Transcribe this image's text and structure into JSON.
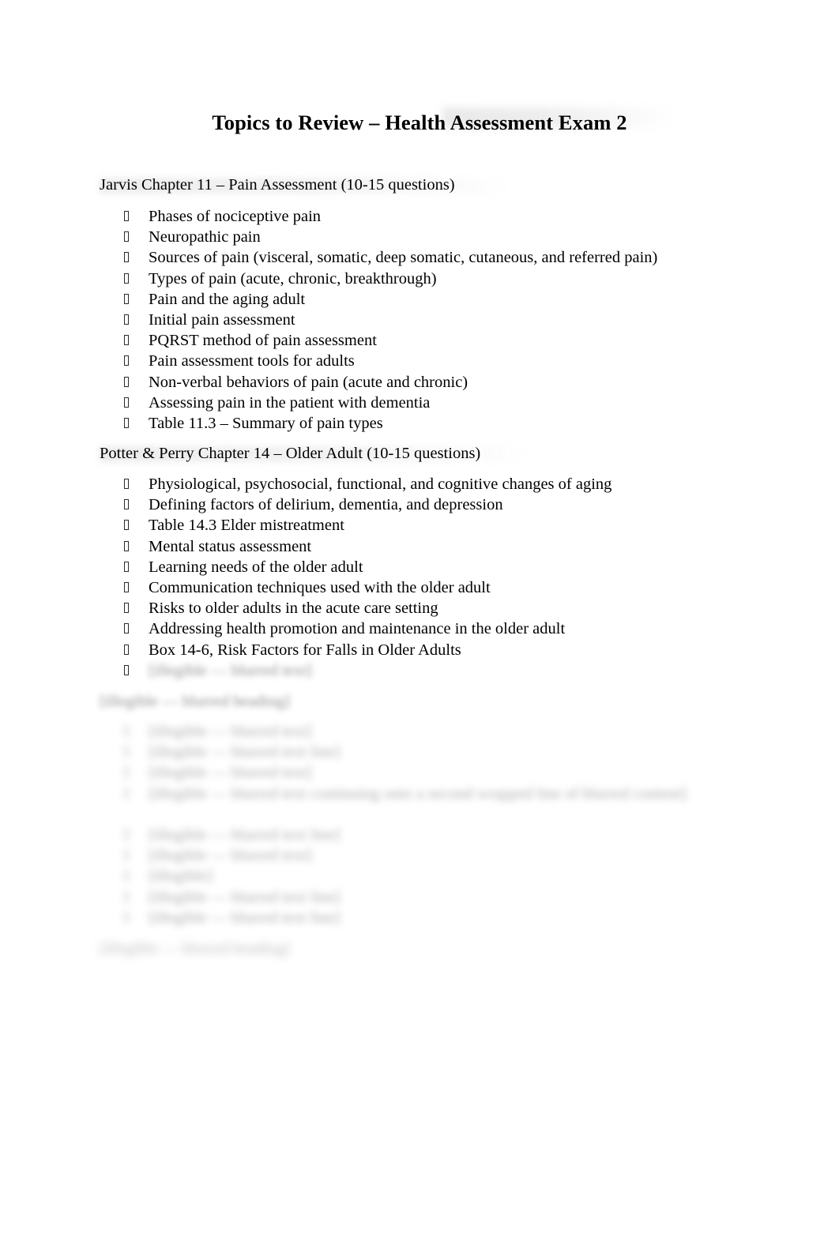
{
  "document": {
    "title": "Topics to Review – Health Assessment Exam 2",
    "bullet_glyph": "missing-glyph-box"
  },
  "sections": [
    {
      "heading": "Jarvis Chapter 11 – Pain Assessment (10-15 questions)",
      "blurred": false,
      "items": [
        {
          "text": "Phases of nociceptive pain",
          "blurred": false
        },
        {
          "text": "Neuropathic pain",
          "blurred": false
        },
        {
          "text": "Sources of pain (visceral, somatic, deep somatic, cutaneous, and referred pain)",
          "blurred": false
        },
        {
          "text": "Types of pain (acute, chronic, breakthrough)",
          "blurred": false
        },
        {
          "text": "Pain and the aging adult",
          "blurred": false
        },
        {
          "text": "Initial pain assessment",
          "blurred": false
        },
        {
          "text": "PQRST method of pain assessment",
          "blurred": false
        },
        {
          "text": "Pain assessment tools for adults",
          "blurred": false
        },
        {
          "text": "Non-verbal behaviors of pain (acute and chronic)",
          "blurred": false
        },
        {
          "text": "Assessing pain in the patient with dementia",
          "blurred": false
        },
        {
          "text": "Table 11.3 – Summary of pain types",
          "blurred": false
        }
      ]
    },
    {
      "heading": "Potter & Perry Chapter 14 – Older Adult (10-15 questions)",
      "blurred": false,
      "items": [
        {
          "text": "Physiological, psychosocial, functional, and cognitive changes of aging",
          "blurred": false
        },
        {
          "text": "Defining factors of delirium, dementia, and depression",
          "blurred": false
        },
        {
          "text": "Table 14.3 Elder mistreatment",
          "blurred": false
        },
        {
          "text": "Mental status assessment",
          "blurred": false
        },
        {
          "text": "Learning needs of the older adult",
          "blurred": false
        },
        {
          "text": "Communication techniques used with the older adult",
          "blurred": false
        },
        {
          "text": "Risks to older adults in the acute care setting",
          "blurred": false
        },
        {
          "text": "Addressing health promotion and maintenance in the older adult",
          "blurred": false
        },
        {
          "text": "Box 14-6, Risk Factors for Falls in Older Adults",
          "blurred": false
        },
        {
          "text": "[illegible — blurred text]",
          "blurred": true
        }
      ]
    },
    {
      "heading": "[illegible — blurred heading]",
      "blurred": true,
      "items": [
        {
          "text": "[illegible — blurred text]",
          "blurred": true
        },
        {
          "text": "[illegible — blurred text line]",
          "blurred": true
        },
        {
          "text": "[illegible — blurred text]",
          "blurred": true
        },
        {
          "text": "[illegible — blurred text continuing onto a second wrapped line of blurred content]",
          "blurred": true
        },
        {
          "text": "[illegible — blurred text line]",
          "blurred": true
        },
        {
          "text": "[illegible — blurred text]",
          "blurred": true
        },
        {
          "text": "[illegible]",
          "blurred": true
        },
        {
          "text": "[illegible — blurred text line]",
          "blurred": true
        },
        {
          "text": "[illegible — blurred text line]",
          "blurred": true
        }
      ]
    },
    {
      "heading": "[illegible — blurred heading]",
      "blurred": true,
      "items": []
    }
  ]
}
